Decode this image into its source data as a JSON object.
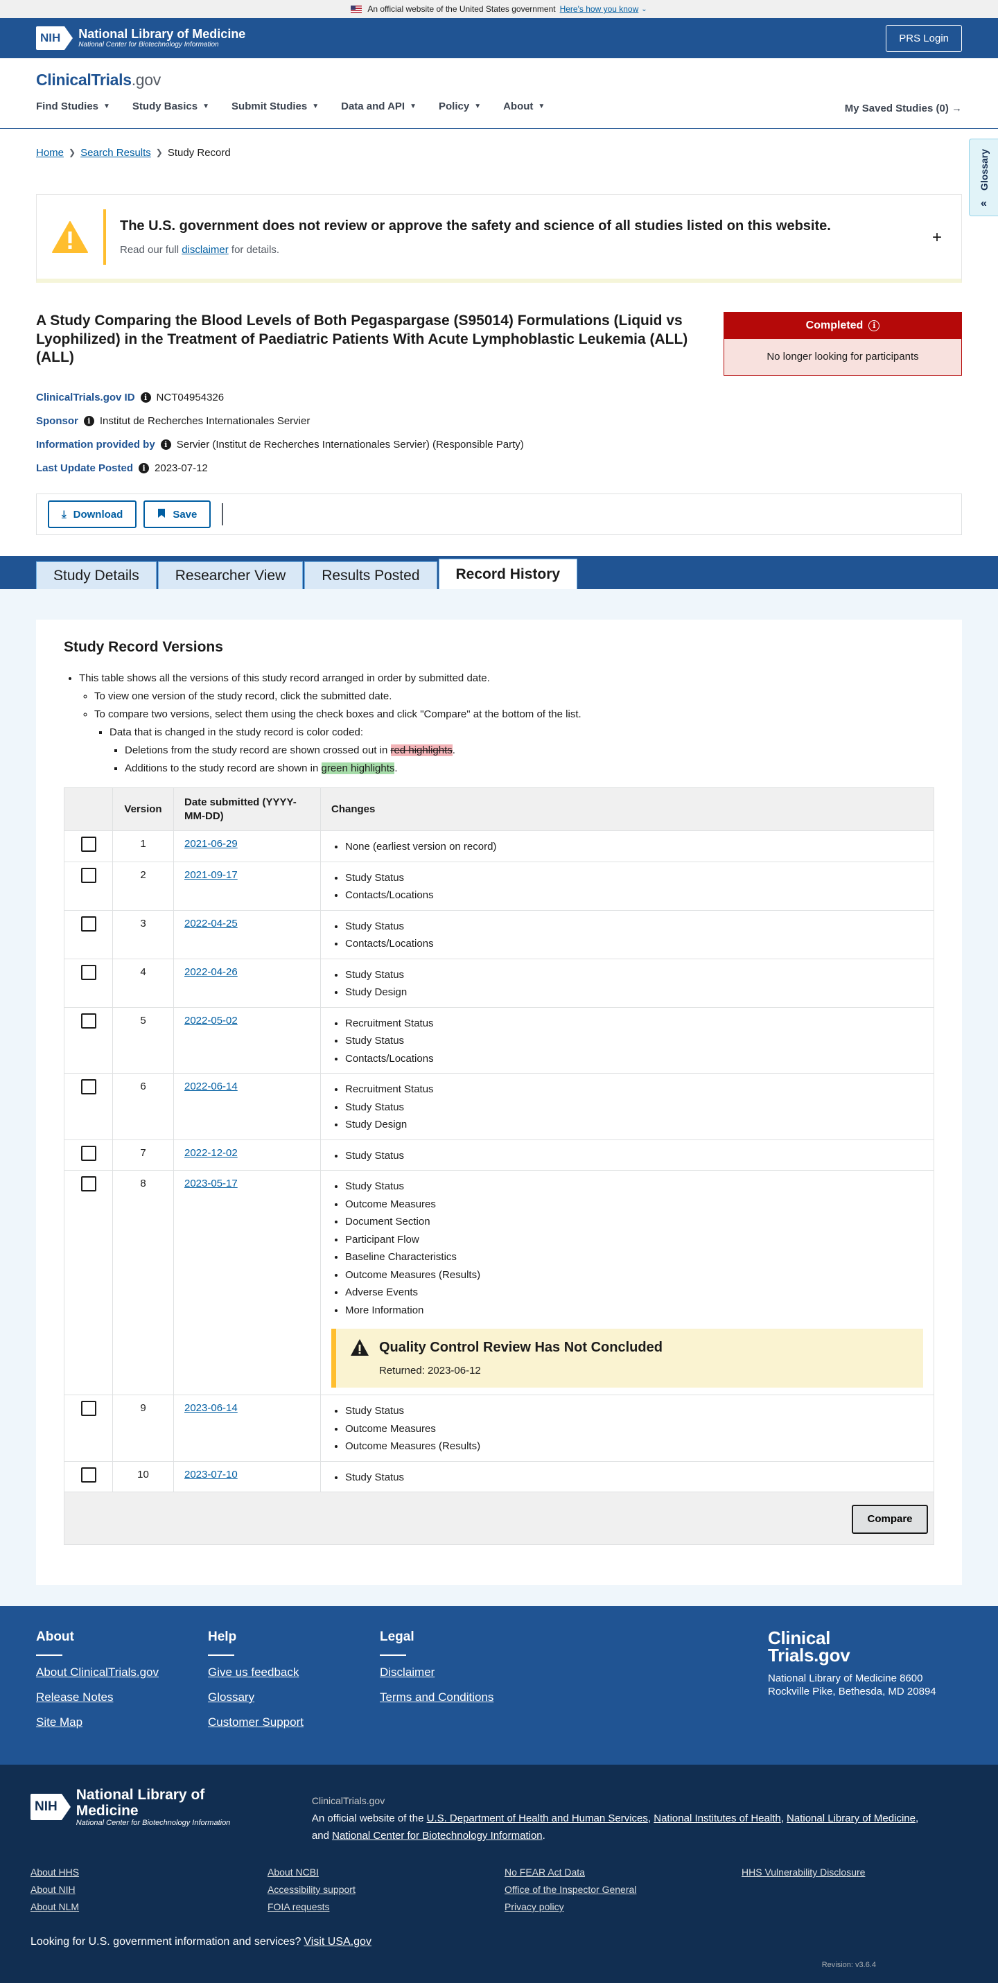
{
  "gov_banner": {
    "text": "An official website of the United States government",
    "link": "Here's how you know"
  },
  "nih": {
    "title": "National Library of Medicine",
    "subtitle": "National Center for Biotechnology Information",
    "badge": "NIH",
    "prs_login": "PRS Login"
  },
  "site": {
    "logo_main": "ClinicalTrials",
    "logo_suffix": ".gov"
  },
  "nav": {
    "items": [
      "Find Studies",
      "Study Basics",
      "Submit Studies",
      "Data and API",
      "Policy",
      "About"
    ],
    "saved": "My Saved Studies (0)"
  },
  "glossary": "Glossary",
  "breadcrumb": {
    "home": "Home",
    "search": "Search Results",
    "current": "Study Record"
  },
  "alert": {
    "title": "The U.S. government does not review or approve the safety and science of all studies listed on this website.",
    "text_before": "Read our full ",
    "link": "disclaimer",
    "text_after": " for details."
  },
  "study": {
    "title": "A Study Comparing the Blood Levels of Both Pegaspargase (S95014) Formulations (Liquid vs Lyophilized) in the Treatment of Paediatric Patients With Acute Lymphoblastic Leukemia (ALL) (ALL)",
    "status": "Completed",
    "status_sub": "No longer looking for participants",
    "id_label": "ClinicalTrials.gov ID",
    "id_value": "NCT04954326",
    "sponsor_label": "Sponsor",
    "sponsor_value": "Institut de Recherches Internationales Servier",
    "provided_label": "Information provided by",
    "provided_value": "Servier (Institut de Recherches Internationales Servier) (Responsible Party)",
    "updated_label": "Last Update Posted",
    "updated_value": "2023-07-12"
  },
  "actions": {
    "download": "Download",
    "save": "Save"
  },
  "tabs": [
    "Study Details",
    "Researcher View",
    "Results Posted",
    "Record History"
  ],
  "versions": {
    "title": "Study Record Versions",
    "intro": "This table shows all the versions of this study record arranged in order by submitted date.",
    "view_one": "To view one version of the study record, click the submitted date.",
    "compare_two": "To compare two versions, select them using the check boxes and click \"Compare\" at the bottom of the list.",
    "color_coded": "Data that is changed in the study record is color coded:",
    "deletions_before": "Deletions from the study record are shown crossed out in ",
    "deletions_hl": "red highlights",
    "additions_before": "Additions to the study record are shown in ",
    "additions_hl": "green highlights",
    "period": ".",
    "col_version": "Version",
    "col_date": "Date submitted (YYYY-MM-DD)",
    "col_changes": "Changes",
    "compare_button": "Compare",
    "qc_title": "Quality Control Review Has Not Concluded",
    "qc_returned": "Returned: 2023-06-12",
    "rows": [
      {
        "version": "1",
        "date": "2021-06-29",
        "changes": [
          "None (earliest version on record)"
        ]
      },
      {
        "version": "2",
        "date": "2021-09-17",
        "changes": [
          "Study Status",
          "Contacts/Locations"
        ]
      },
      {
        "version": "3",
        "date": "2022-04-25",
        "changes": [
          "Study Status",
          "Contacts/Locations"
        ]
      },
      {
        "version": "4",
        "date": "2022-04-26",
        "changes": [
          "Study Status",
          "Study Design"
        ]
      },
      {
        "version": "5",
        "date": "2022-05-02",
        "changes": [
          "Recruitment Status",
          "Study Status",
          "Contacts/Locations"
        ]
      },
      {
        "version": "6",
        "date": "2022-06-14",
        "changes": [
          "Recruitment Status",
          "Study Status",
          "Study Design"
        ]
      },
      {
        "version": "7",
        "date": "2022-12-02",
        "changes": [
          "Study Status"
        ]
      },
      {
        "version": "8",
        "date": "2023-05-17",
        "changes": [
          "Study Status",
          "Outcome Measures",
          "Document Section",
          "Participant Flow",
          "Baseline Characteristics",
          "Outcome Measures (Results)",
          "Adverse Events",
          "More Information"
        ],
        "qc": true
      },
      {
        "version": "9",
        "date": "2023-06-14",
        "changes": [
          "Study Status",
          "Outcome Measures",
          "Outcome Measures (Results)"
        ]
      },
      {
        "version": "10",
        "date": "2023-07-10",
        "changes": [
          "Study Status"
        ]
      }
    ]
  },
  "footer": {
    "about": {
      "title": "About",
      "links": [
        "About ClinicalTrials.gov",
        "Release Notes",
        "Site Map"
      ]
    },
    "help": {
      "title": "Help",
      "links": [
        "Give us feedback",
        "Glossary",
        "Customer Support"
      ]
    },
    "legal": {
      "title": "Legal",
      "links": [
        "Disclaimer",
        "Terms and Conditions"
      ]
    },
    "brand_line1": "Clinical",
    "brand_line2": "Trials.gov",
    "address": "National Library of Medicine 8600 Rockville Pike, Bethesda, MD 20894"
  },
  "nlm_footer": {
    "site": "ClinicalTrials.gov",
    "official_prefix": "An official website of the ",
    "hhs": "U.S. Department of Health and Human Services",
    "nih": "National Institutes of Health",
    "nlm": "National Library of Medicine",
    "ncbi": "National Center for Biotechnology Information",
    "and": "and ",
    "links": [
      "About HHS",
      "About NCBI",
      "No FEAR Act Data",
      "HHS Vulnerability Disclosure",
      "About NIH",
      "Accessibility support",
      "Office of the Inspector General",
      "",
      "About NLM",
      "FOIA requests",
      "Privacy policy",
      ""
    ],
    "usa_text": "Looking for U.S. government information and services?",
    "usa_link": "Visit USA.gov",
    "revision": "Revision: v3.6.4"
  }
}
